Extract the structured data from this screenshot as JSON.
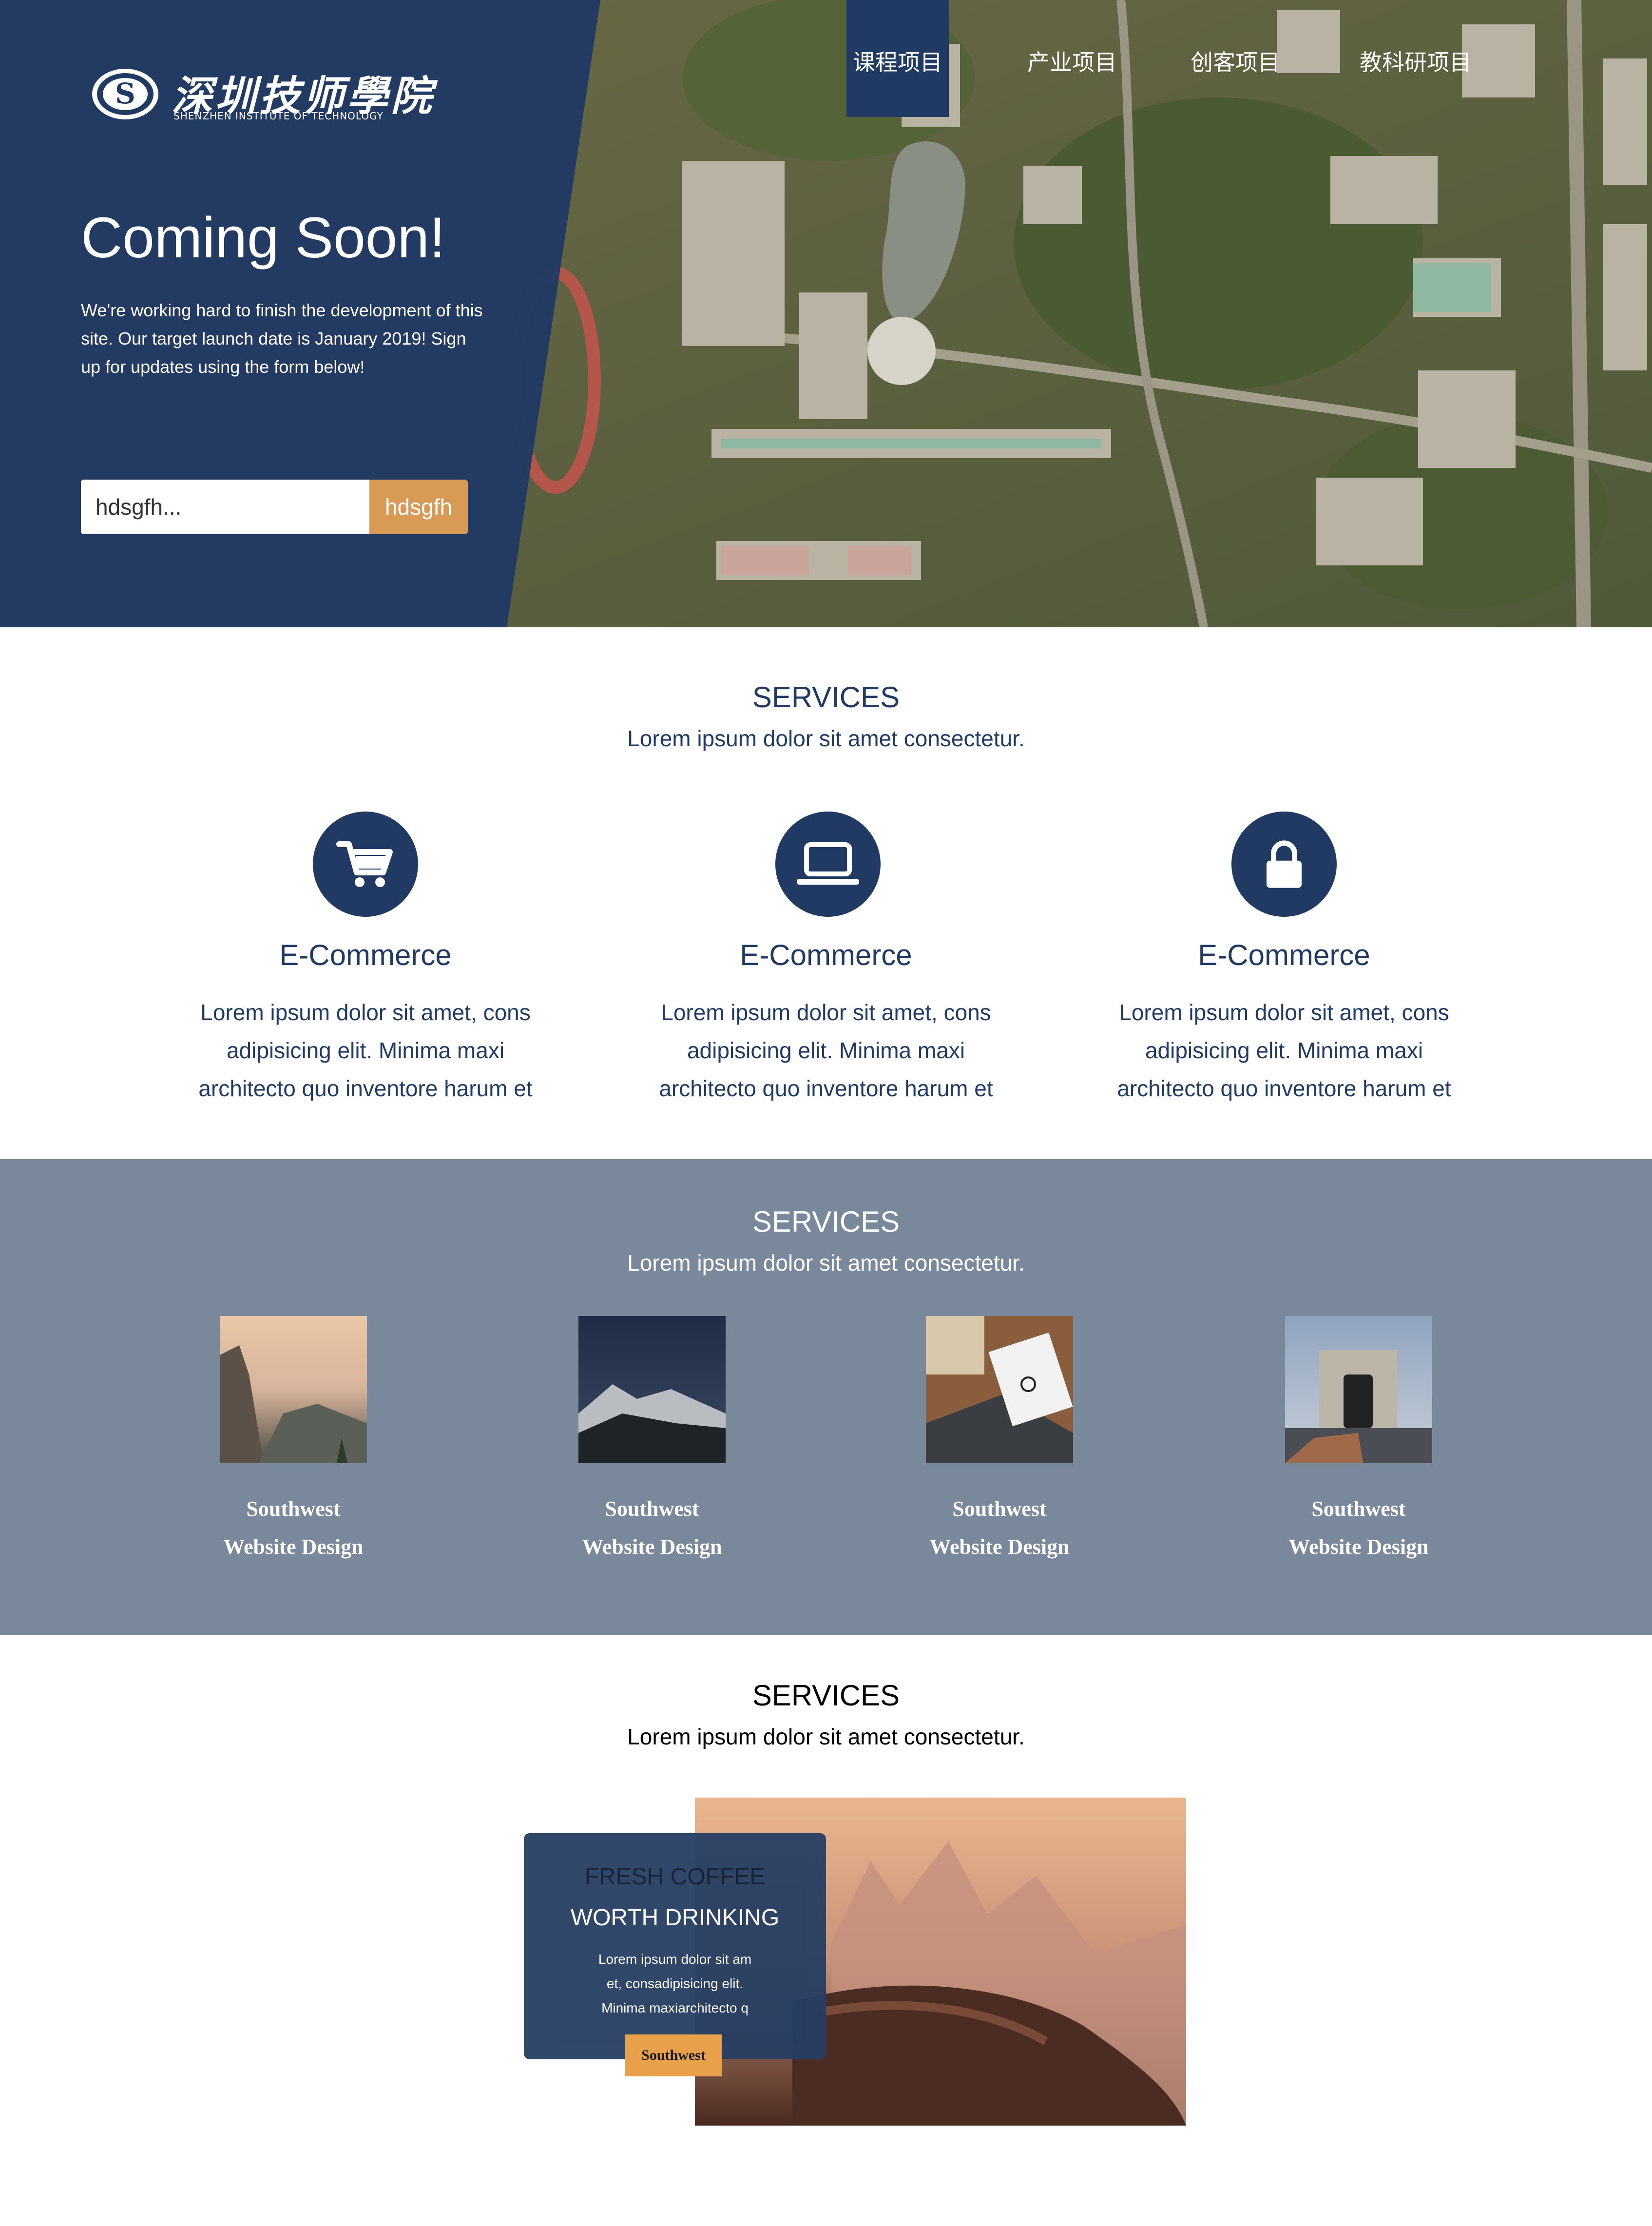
{
  "brand": {
    "name_cn": "深圳技师學院",
    "name_en": "SHENZHEN INSTITUTE OF TECHNOLOGY"
  },
  "nav": {
    "items": [
      {
        "label": "课程项目",
        "active": true
      },
      {
        "label": "产业项目",
        "active": false
      },
      {
        "label": "创客项目",
        "active": false
      },
      {
        "label": "教科研项目",
        "active": false
      }
    ]
  },
  "hero": {
    "title": "Coming Soon!",
    "text": "We're working hard to finish the development of this site. Our target launch date is January 2019! Sign up for updates using the form below!",
    "input_value": "hdsgfh...",
    "button_label": "hdsgfh"
  },
  "services1": {
    "title": "SERVICES",
    "subtitle": "Lorem ipsum dolor sit amet consectetur.",
    "features": [
      {
        "icon": "shopping-cart-icon",
        "title": "E-Commerce",
        "text": "Lorem ipsum dolor sit amet, cons adipisicing elit. Minima maxi architecto quo inventore harum et"
      },
      {
        "icon": "laptop-icon",
        "title": "E-Commerce",
        "text": "Lorem ipsum dolor sit amet, cons adipisicing elit. Minima maxi architecto quo inventore harum et"
      },
      {
        "icon": "lock-icon",
        "title": "E-Commerce",
        "text": "Lorem ipsum dolor sit amet, cons adipisicing elit. Minima maxi architecto quo inventore harum et"
      }
    ]
  },
  "services2": {
    "title": "SERVICES",
    "subtitle": "Lorem ipsum dolor sit amet consectetur.",
    "tiles": [
      {
        "line1": "Southwest",
        "line2": "Website Design",
        "image": "mountain-sunset-photo"
      },
      {
        "line1": "Southwest",
        "line2": "Website Design",
        "image": "snowy-mountain-photo"
      },
      {
        "line1": "Southwest",
        "line2": "Website Design",
        "image": "laptop-desk-photo"
      },
      {
        "line1": "Southwest",
        "line2": "Website Design",
        "image": "arc-de-triomphe-photo"
      }
    ]
  },
  "services3": {
    "title": "SERVICES",
    "subtitle": "Lorem ipsum dolor sit amet consectetur.",
    "card": {
      "title1": "FRESH COFFEE",
      "title2": "WORTH DRINKING",
      "text": "Lorem ipsum dolor sit am et, consadipisicing elit. Minima maxiarchitecto q",
      "button_label": "Southwest"
    }
  },
  "colors": {
    "navy": "#213a63",
    "accent": "#d99a55",
    "band": "#7a889c",
    "card_button": "#e8a04b"
  }
}
